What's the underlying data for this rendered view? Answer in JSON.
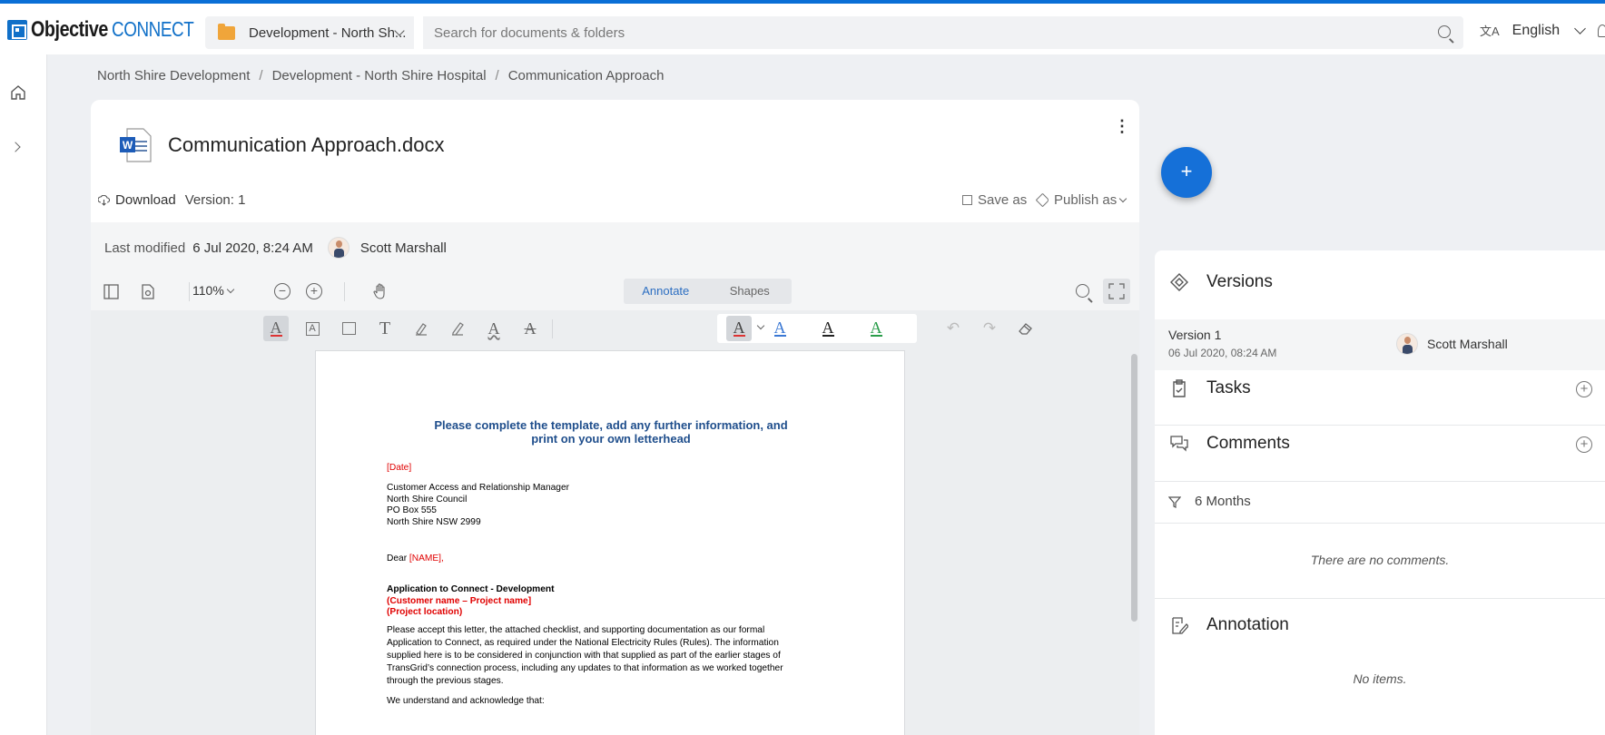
{
  "header": {
    "logo_bold": "Objective",
    "logo_light": "CONNECT",
    "workspace": "Development - North Sh...",
    "search_placeholder": "Search for documents & folders",
    "language": "English"
  },
  "breadcrumb": [
    "North Shire Development",
    "Development - North Shire Hospital",
    "Communication Approach"
  ],
  "document": {
    "title": "Communication Approach.docx",
    "download": "Download",
    "version": "Version: 1",
    "save_as": "Save as",
    "publish_as": "Publish as",
    "last_modified_label": "Last modified",
    "last_modified_date": "6 Jul 2020, 8:24 AM",
    "modified_by": "Scott Marshall"
  },
  "viewer": {
    "zoom": "110%",
    "tabs": [
      "Annotate",
      "Shapes"
    ]
  },
  "page": {
    "heading_line1": "Please complete the template, add any further information, and",
    "heading_line2": "print on your own letterhead",
    "date": "[Date]",
    "address": [
      "Customer Access and Relationship Manager",
      "North Shire Council",
      "PO Box 555",
      "North Shire NSW 2999"
    ],
    "dear": "Dear ",
    "name": "[NAME],",
    "subject": "Application to Connect - Development",
    "customer": "(Customer name – Project name]",
    "location": "(Project location)",
    "body": [
      "Please accept this letter, the attached checklist, and supporting documentation as our formal",
      "Application to Connect, as required under the National Electricity Rules (Rules). The information",
      "supplied here is to be considered in conjunction with that supplied as part of the earlier stages of",
      "TransGrid’s connection process, including any updates to that information as we worked together",
      "through the previous stages."
    ],
    "last_line": "We understand and acknowledge that:"
  },
  "panel": {
    "versions_title": "Versions",
    "version_name": "Version 1",
    "version_date": "06 Jul 2020, 08:24 AM",
    "version_user": "Scott Marshall",
    "tasks_title": "Tasks",
    "comments_title": "Comments",
    "filter": "6 Months",
    "no_comments": "There are no comments.",
    "annotation_title": "Annotation",
    "no_items": "No items."
  },
  "colors": {
    "brand": "#1070c8",
    "fab": "#1570d8",
    "heading": "#1f4e8c",
    "placeholder_red": "#e00000"
  }
}
